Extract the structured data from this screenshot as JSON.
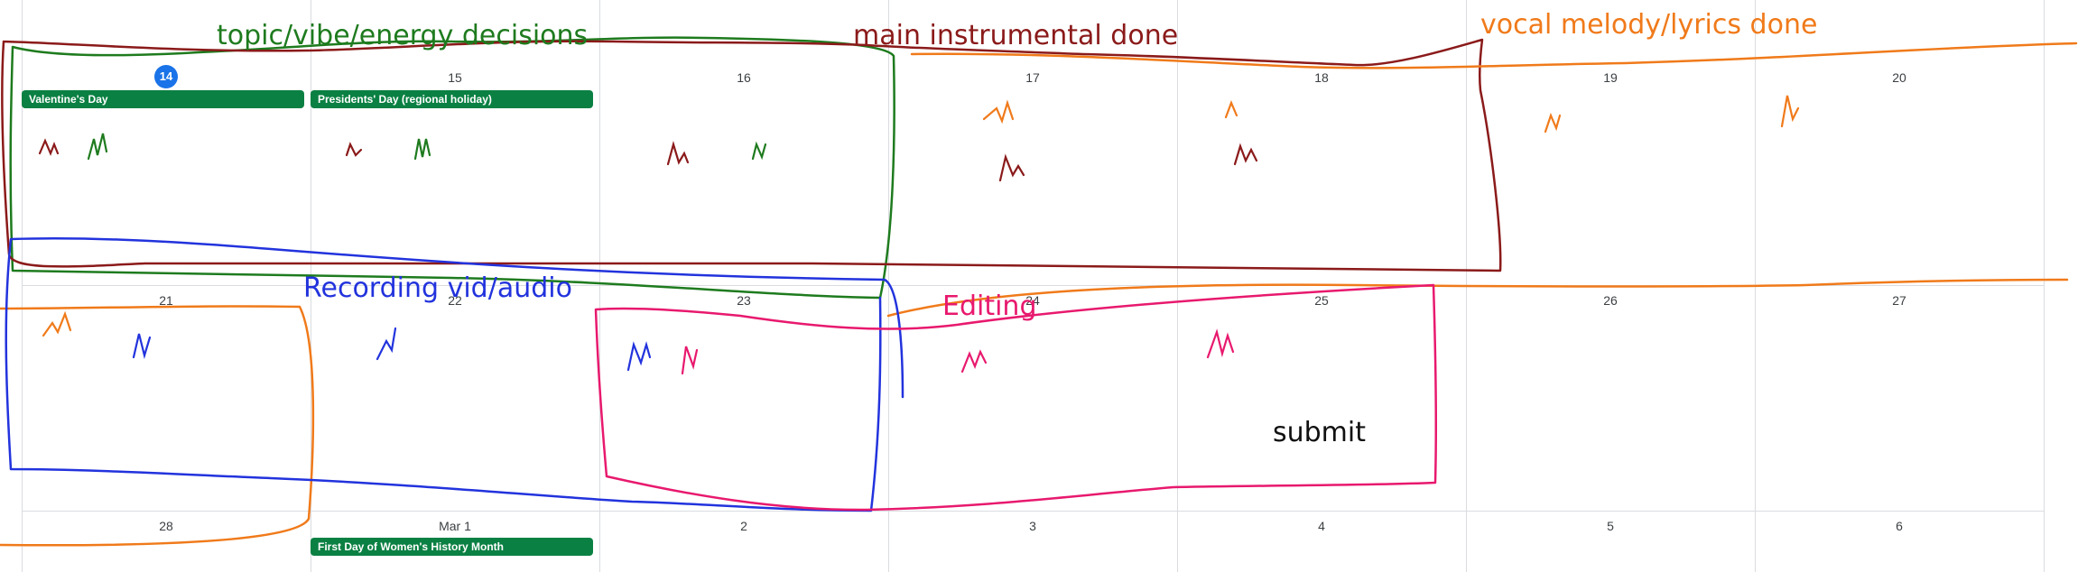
{
  "calendar": {
    "today_badge": "14",
    "weeks": [
      [
        "",
        "15",
        "16",
        "17",
        "18",
        "19",
        "20"
      ],
      [
        "21",
        "22",
        "23",
        "24",
        "25",
        "26",
        "27"
      ],
      [
        "28",
        "Mar 1",
        "2",
        "3",
        "4",
        "5",
        "6"
      ]
    ],
    "events": {
      "valentines": "Valentine's Day",
      "presidents": "Presidents' Day (regional holiday)",
      "womens_history": "First Day of Women's History Month"
    },
    "event_color": "#0b8043",
    "today_color": "#1a73e8"
  },
  "annotations": {
    "topic": {
      "text": "topic/vibe/energy decisions",
      "color": "#1e7b1e"
    },
    "instrumental": {
      "text": "main instrumental done",
      "color": "#8b1a1a"
    },
    "vocal": {
      "text": "vocal melody/lyrics done",
      "color": "#f07a1a"
    },
    "recording": {
      "text": "Recording vid/audio",
      "color": "#2233dd"
    },
    "editing": {
      "text": "Editing",
      "color": "#e8196e"
    },
    "submit": {
      "text": "submit",
      "color": "#111111"
    }
  }
}
